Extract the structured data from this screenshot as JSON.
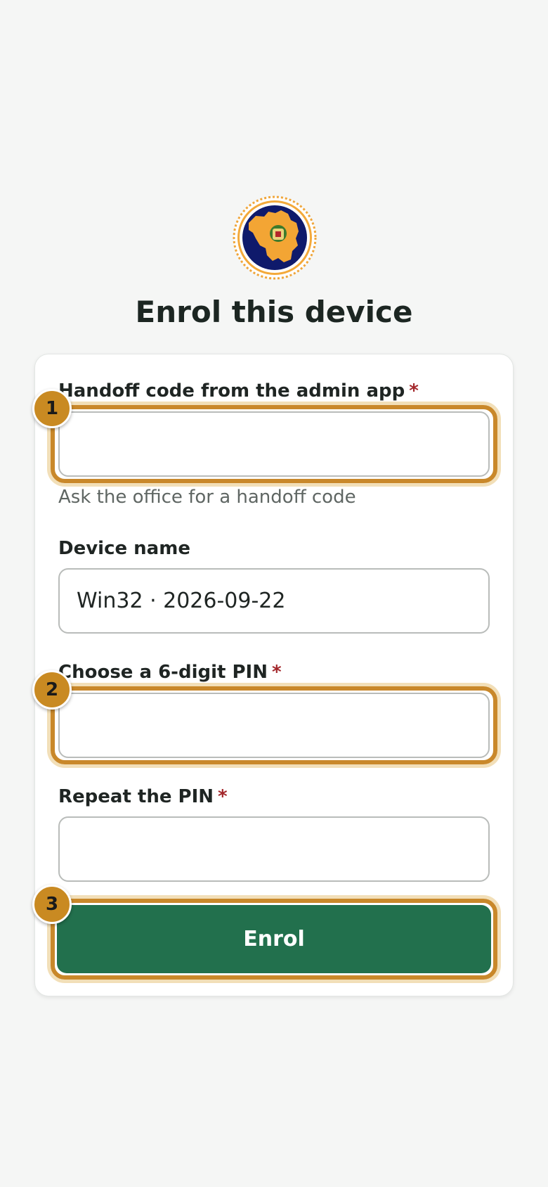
{
  "header": {
    "logo_icon": "district-emblem-icon",
    "title": "Enrol this device"
  },
  "form": {
    "handoff": {
      "label": "Handoff code from the admin app",
      "required_mark": "*",
      "value": "",
      "hint": "Ask the office for a handoff code"
    },
    "device_name": {
      "label": "Device name",
      "value": "Win32 · 2026-09-22"
    },
    "pin": {
      "label": "Choose a 6-digit PIN",
      "required_mark": "*",
      "value": ""
    },
    "pin_repeat": {
      "label": "Repeat the PIN",
      "required_mark": "*",
      "value": ""
    },
    "submit_label": "Enrol"
  },
  "steps": [
    {
      "number": "1"
    },
    {
      "number": "2"
    },
    {
      "number": "3"
    }
  ],
  "colors": {
    "accent_highlight": "#c9882a",
    "primary_button": "#22704d",
    "required": "#a3272b",
    "background": "#f5f6f5"
  }
}
